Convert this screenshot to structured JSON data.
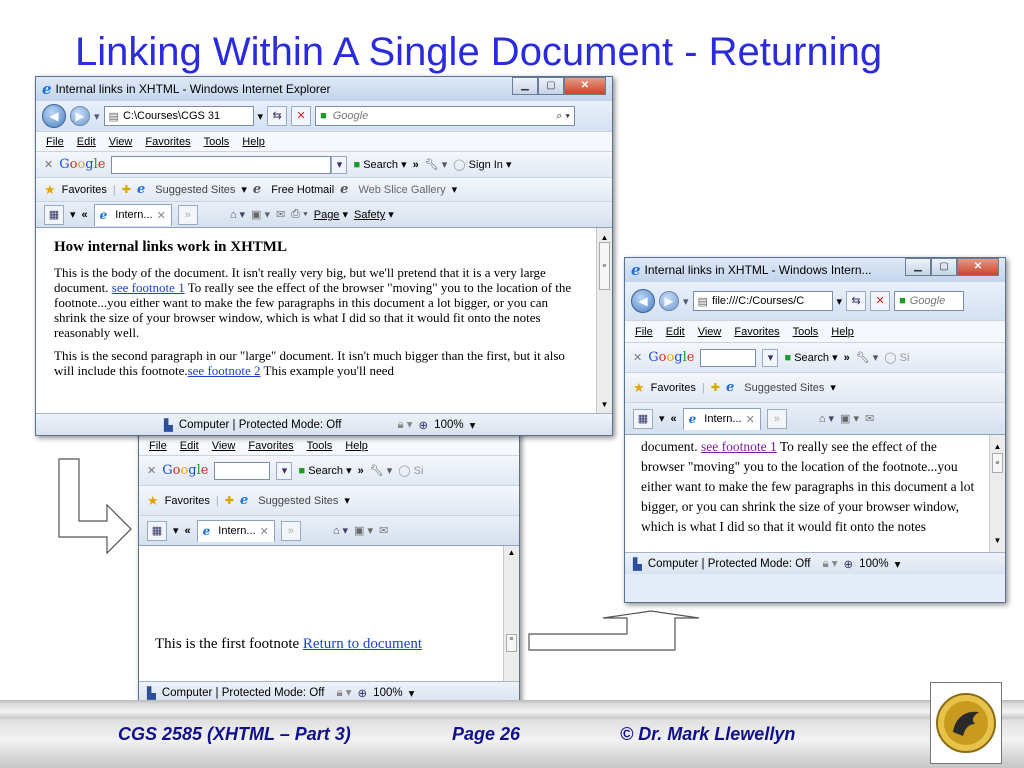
{
  "slide": {
    "title": "Linking Within A Single Document - Returning",
    "footer_course": "CGS 2585 (XHTML – Part 3)",
    "footer_page": "Page 26",
    "footer_author": "© Dr. Mark Llewellyn"
  },
  "windows": [
    {
      "title": "Internal links in XHTML - Windows Internet Explorer",
      "address": "C:\\Courses\\CGS 31",
      "search_placeholder": "Google",
      "menu": [
        "File",
        "Edit",
        "View",
        "Favorites",
        "Tools",
        "Help"
      ],
      "google_search_label": "Search",
      "sign_in_label": "Sign In",
      "favorites_label": "Favorites",
      "suggested_sites": "Suggested Sites",
      "free_hotmail": "Free Hotmail",
      "web_slice_gallery": "Web Slice Gallery",
      "tab_label": "Intern...",
      "page_menu": "Page",
      "safety_menu": "Safety",
      "heading": "How internal links work in XHTML",
      "para1_a": "This is the body of the document. It isn't really very big, but we'll pretend that it is a very large document.",
      "para1_link": "see footnote 1",
      "para1_b": "To really see the effect of the browser \"moving\" you to the location of the footnote...you either want to make the few paragraphs in this document a lot bigger, or you can shrink the size of your browser window, which is what I did so that it would fit onto the notes reasonably well.",
      "para2_a": "This is the second paragraph in our \"large\" document. It isn't much bigger than the first, but it also will include this footnote.",
      "para2_link": "see footnote 2",
      "para2_b": "This example you'll need",
      "status": "Computer | Protected Mode: Off",
      "zoom": "100%"
    },
    {
      "menu": [
        "File",
        "Edit",
        "View",
        "Favorites",
        "Tools",
        "Help"
      ],
      "google_search_label": "Search",
      "favorites_label": "Favorites",
      "suggested_sites": "Suggested Sites",
      "tab_label": "Intern...",
      "footnote_text": "This is the first footnote",
      "footnote_link": "Return to document",
      "status": "Computer | Protected Mode: Off",
      "zoom": "100%"
    },
    {
      "title": "Internal links in XHTML - Windows Intern...",
      "address": "file:///C:/Courses/C",
      "search_placeholder": "Google",
      "menu": [
        "File",
        "Edit",
        "View",
        "Favorites",
        "Tools",
        "Help"
      ],
      "google_search_label": "Search",
      "favorites_label": "Favorites",
      "suggested_sites": "Suggested Sites",
      "tab_label": "Intern...",
      "body_a": "document.",
      "body_link": "see footnote 1",
      "body_b": "To really see the effect of the browser \"moving\" you to the location of the footnote...you either want to make the few paragraphs in this document a lot bigger, or you can shrink the size of your browser window, which is what I did so that it would fit onto the notes",
      "status": "Computer | Protected Mode: Off",
      "zoom": "100%"
    }
  ]
}
